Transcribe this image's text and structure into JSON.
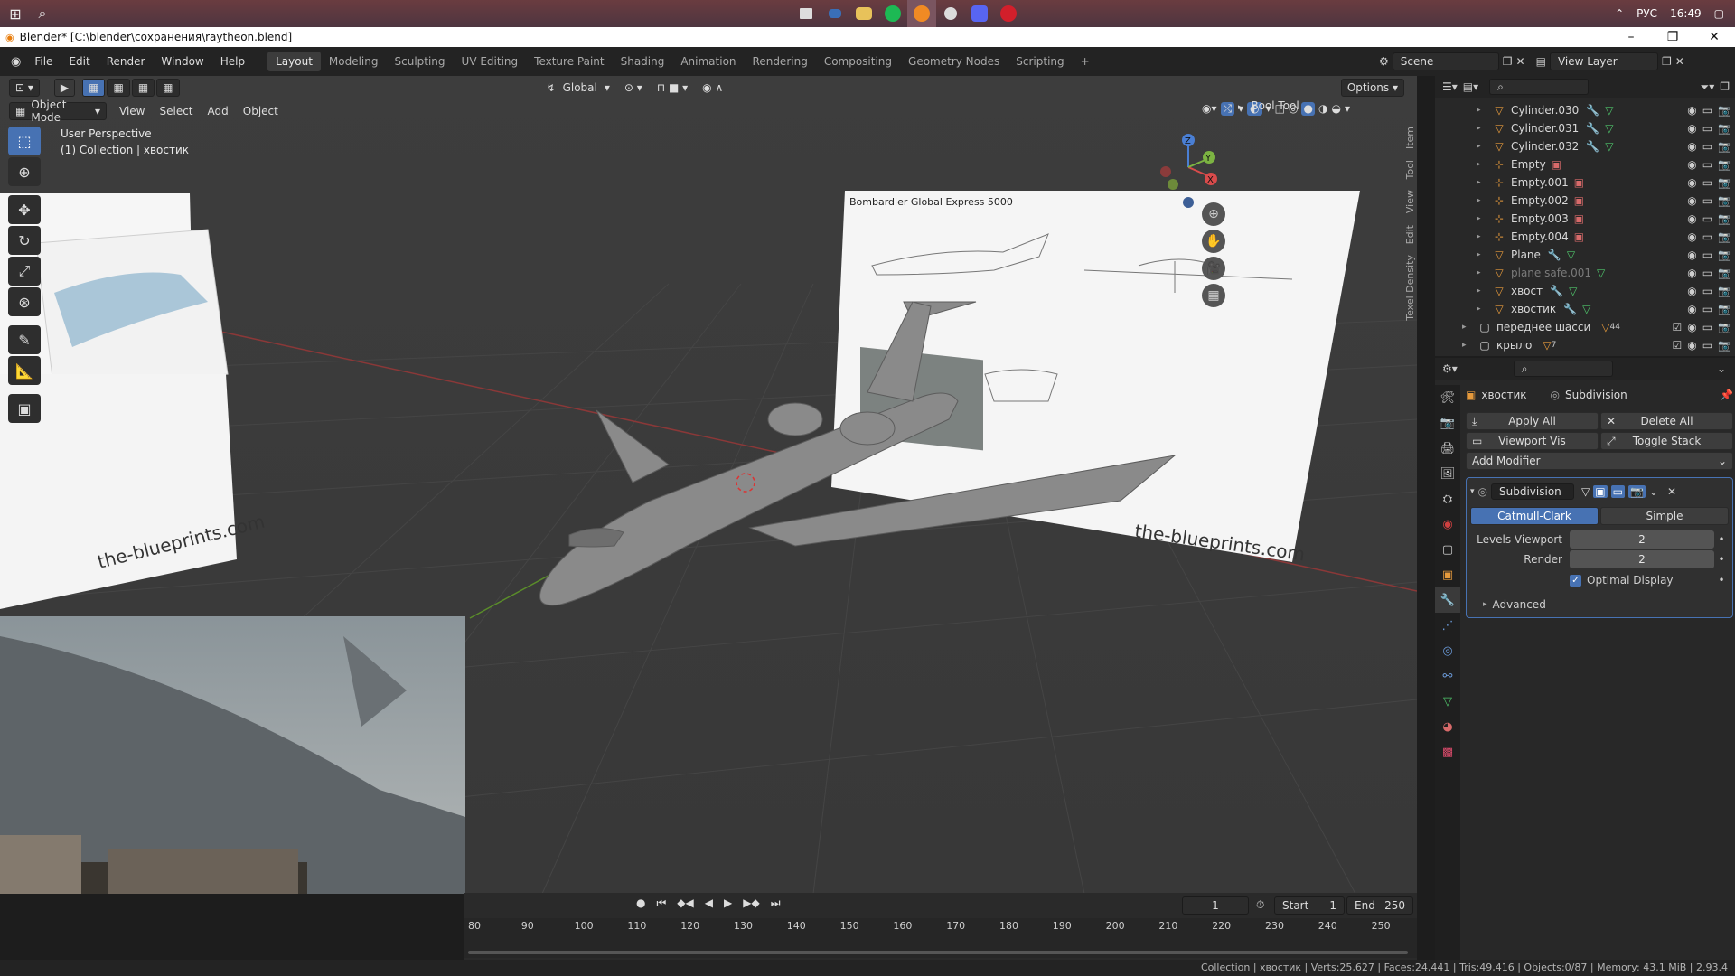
{
  "taskbar": {
    "lang": "РУС",
    "time": "16:49"
  },
  "window": {
    "title": "Blender* [C:\\blender\\сохранения\\raytheon.blend]"
  },
  "topbar": {
    "menus": [
      "File",
      "Edit",
      "Render",
      "Window",
      "Help"
    ],
    "workspaces": [
      "Layout",
      "Modeling",
      "Sculpting",
      "UV Editing",
      "Texture Paint",
      "Shading",
      "Animation",
      "Rendering",
      "Compositing",
      "Geometry Nodes",
      "Scripting"
    ],
    "add_tab": "+",
    "scene": "Scene",
    "view_layer": "View Layer"
  },
  "viewport": {
    "orientation": "Global",
    "options": "Options",
    "mode": "Object Mode",
    "menus": [
      "View",
      "Select",
      "Add",
      "Object"
    ],
    "overlay_line1": "User Perspective",
    "overlay_line2": "(1) Collection | хвостик",
    "bool_tool": "Bool Tool",
    "side_tabs": [
      "Item",
      "Tool",
      "View",
      "Edit",
      "Texel Density"
    ],
    "blueprint_title": "Bombardier Global Express 5000",
    "watermark": "the-blueprints.com",
    "gizmo": {
      "z": "Z",
      "y": "Y",
      "x": "X"
    }
  },
  "timeline": {
    "current_frame": "1",
    "start_label": "Start",
    "start": "1",
    "end_label": "End",
    "end": "250",
    "ticks": [
      "80",
      "90",
      "100",
      "110",
      "120",
      "130",
      "140",
      "150",
      "160",
      "170",
      "180",
      "190",
      "200",
      "210",
      "220",
      "230",
      "240",
      "250"
    ]
  },
  "status": "Collection | хвостик | Verts:25,627 | Faces:24,441 | Tris:49,416 | Objects:0/87 | Memory: 43.1 MiB | 2.93.4",
  "outliner": {
    "items": [
      {
        "name": "Cylinder.030",
        "type": "mesh",
        "mod": true,
        "faded": false
      },
      {
        "name": "Cylinder.031",
        "type": "mesh",
        "mod": true,
        "faded": false
      },
      {
        "name": "Cylinder.032",
        "type": "mesh",
        "mod": true,
        "faded": false
      },
      {
        "name": "Empty",
        "type": "empty",
        "mod": false,
        "faded": false
      },
      {
        "name": "Empty.001",
        "type": "empty",
        "mod": false,
        "faded": false
      },
      {
        "name": "Empty.002",
        "type": "empty",
        "mod": false,
        "faded": false
      },
      {
        "name": "Empty.003",
        "type": "empty",
        "mod": false,
        "faded": false
      },
      {
        "name": "Empty.004",
        "type": "empty",
        "mod": false,
        "faded": false
      },
      {
        "name": "Plane",
        "type": "mesh",
        "mod": true,
        "faded": false
      },
      {
        "name": "plane safe.001",
        "type": "mesh",
        "mod": false,
        "faded": true
      },
      {
        "name": "хвост",
        "type": "mesh",
        "mod": true,
        "faded": false
      },
      {
        "name": "хвостик",
        "type": "mesh",
        "mod": true,
        "faded": false
      }
    ],
    "collections": [
      {
        "name": "переднее шасси",
        "count": "44"
      },
      {
        "name": "крыло",
        "count": "7"
      }
    ]
  },
  "properties": {
    "object": "хвостик",
    "modifier_context": "Subdivision",
    "apply_all": "Apply All",
    "delete_all": "Delete All",
    "viewport_vis": "Viewport Vis",
    "toggle_stack": "Toggle Stack",
    "add_modifier": "Add Modifier",
    "modifier_name": "Subdivision",
    "catmull": "Catmull-Clark",
    "simple": "Simple",
    "levels_viewport_label": "Levels Viewport",
    "levels_viewport": "2",
    "render_label": "Render",
    "render": "2",
    "optimal_display": "Optimal Display",
    "advanced": "Advanced"
  }
}
